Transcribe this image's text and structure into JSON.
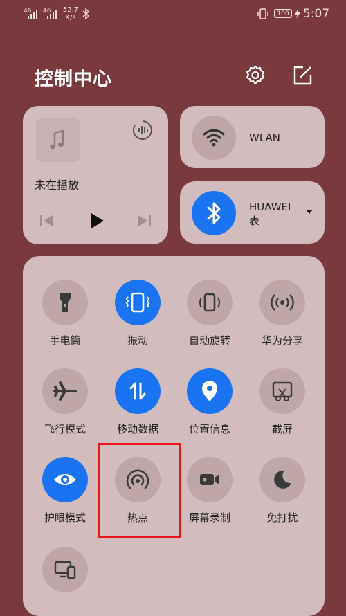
{
  "status_bar": {
    "signal1": "46",
    "signal2": "46",
    "net_speed_value": "52.7",
    "net_speed_unit": "K/s",
    "battery": "100",
    "time": "5:07"
  },
  "header": {
    "title": "控制中心"
  },
  "media": {
    "status": "未在播放"
  },
  "wlan": {
    "label": "WLAN"
  },
  "bluetooth": {
    "label_line1": "HUAWEI",
    "label_line2": "表"
  },
  "tiles": [
    {
      "label": "手电筒",
      "icon": "flashlight-icon",
      "active": false
    },
    {
      "label": "振动",
      "icon": "vibrate-icon",
      "active": true
    },
    {
      "label": "自动旋转",
      "icon": "auto-rotate-icon",
      "active": false
    },
    {
      "label": "华为分享",
      "icon": "huawei-share-icon",
      "active": false
    },
    {
      "label": "飞行模式",
      "icon": "airplane-icon",
      "active": false
    },
    {
      "label": "移动数据",
      "icon": "mobile-data-icon",
      "active": true
    },
    {
      "label": "位置信息",
      "icon": "location-icon",
      "active": true
    },
    {
      "label": "截屏",
      "icon": "screenshot-icon",
      "active": false
    },
    {
      "label": "护眼模式",
      "icon": "eye-comfort-icon",
      "active": true
    },
    {
      "label": "热点",
      "icon": "hotspot-icon",
      "active": false
    },
    {
      "label": "屏幕录制",
      "icon": "screen-record-icon",
      "active": false
    },
    {
      "label": "免打扰",
      "icon": "do-not-disturb-icon",
      "active": false
    },
    {
      "label": "",
      "icon": "multi-screen-icon",
      "active": false
    }
  ],
  "colors": {
    "background": "#7a3a3d",
    "card": "#d2bcbd",
    "accent": "#1a73f0",
    "highlight": "#e8141a"
  }
}
